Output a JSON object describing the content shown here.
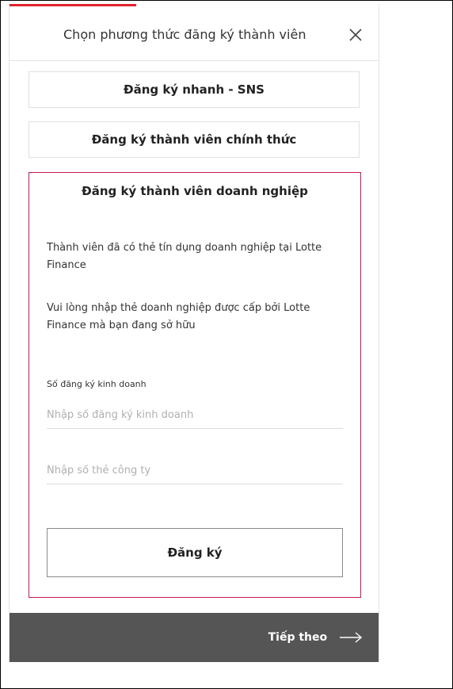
{
  "header": {
    "title": "Chọn phương thức đăng ký thành viên",
    "close_icon": "close-icon"
  },
  "options": {
    "sns_label": "Đăng ký nhanh - SNS",
    "official_label": "Đăng ký thành viên chính thức"
  },
  "business": {
    "title": "Đăng ký thành viên doanh nghiệp",
    "description_1": "Thành viên đã có thẻ tín dụng doanh nghiệp tại Lotte Finance",
    "description_2": "Vui lòng nhập thẻ doanh nghiệp được cấp bởi Lotte Finance mà bạn đang sở hữu",
    "field_label": "Số đăng ký kinh doanh",
    "business_number": {
      "value": "",
      "placeholder": "Nhập số đăng ký kinh doanh"
    },
    "card_number": {
      "value": "",
      "placeholder": "Nhập số thẻ công ty"
    },
    "register_label": "Đăng ký"
  },
  "footer": {
    "next_label": "Tiếp theo",
    "next_icon": "arrow-right-icon"
  },
  "colors": {
    "accent": "#e0232e",
    "business_border": "#c8174f",
    "footer_bg": "#555555"
  }
}
